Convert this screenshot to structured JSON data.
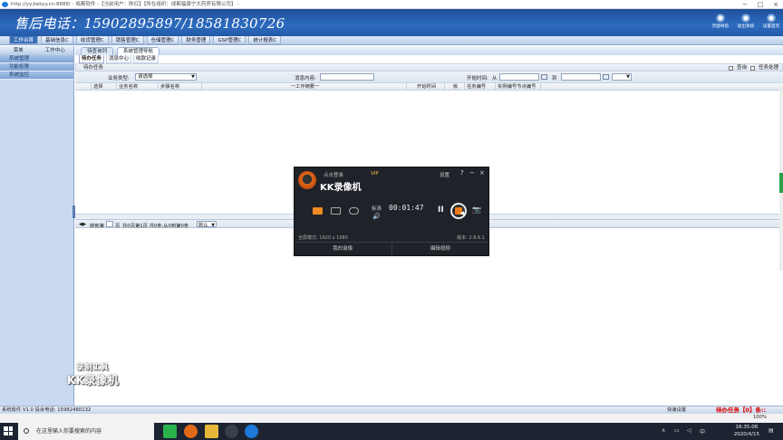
{
  "window": {
    "title": "http://yy.bekyy.cn:8888/ - 成都软件 -【当前用户：陈红】【所在组织：成都福康宁大药房有限公司】 -",
    "controls": [
      "−",
      "□",
      "×"
    ]
  },
  "banner": {
    "hotline": "售后电话：15902895897/18581830726",
    "tools": [
      {
        "label": "页面导航",
        "icon": "navigation-icon"
      },
      {
        "label": "退出系统",
        "icon": "logout-icon"
      },
      {
        "label": "设置首页",
        "icon": "home-settings-icon"
      }
    ]
  },
  "menubar": {
    "items": [
      "工作台首",
      "基础信息C",
      "收货管理C",
      "销售管理C",
      "仓储管理C",
      "财务管理",
      "GSP管理C",
      "统计报表C"
    ]
  },
  "sidebar": {
    "tabs": [
      "菜单",
      "工作中心"
    ],
    "items": [
      "系统管理",
      "功能权限",
      "系统监控"
    ]
  },
  "main": {
    "page_tabs": [
      "待查询列",
      "系统管理导航"
    ],
    "sub_tabs": [
      "待办任务",
      "消息中心",
      "收款记录"
    ],
    "panel_title": "待办任务",
    "panel_right": {
      "query": "查询",
      "toggle": "任务处理"
    },
    "filter": {
      "type_label": "业务类型:",
      "type_value": "请选择",
      "content_label": "消息内容:",
      "content_value": "",
      "start_label": "开始时间:",
      "from": "从",
      "to": "到",
      "from_value": "",
      "to_value": "",
      "range_value": ""
    },
    "columns": [
      "选择",
      "业务名称",
      "步骤名称",
      "一工作摘要一",
      "开始时间",
      "级",
      "任务编号",
      "实例编号节点编号"
    ],
    "pager": {
      "goto": "转到第",
      "page_unit": "页",
      "summary": "共0页第1页 共0条,从0到第0条",
      "page_size": "默认"
    }
  },
  "recorder": {
    "login": "点击登录",
    "vip": "VIP",
    "name": "KK录像机",
    "settings": "设置",
    "ctl_help": "?",
    "ctl_min": "−",
    "ctl_close": "×",
    "quality": "标清",
    "time": "00:01:47",
    "mode": "全屏模式: 1920 x 1080",
    "version": "版本: 2.8.6.1",
    "footer": [
      "我的录像",
      "编辑视频"
    ],
    "icons": {
      "volume": "🔊",
      "pause": "II",
      "camera": "📷"
    }
  },
  "watermark": {
    "line1": "录制工具",
    "line2": "KK录像机"
  },
  "statusbar": {
    "left": "系统软件 V1.0 投诉电话: 15982480132",
    "quick": "快速设置",
    "pending": "待办任务【0】条::"
  },
  "zoombar": {
    "zoom": "100%"
  },
  "taskbar": {
    "search_placeholder": "在这里输入你要搜索的内容",
    "clock_time": "16:35:06",
    "clock_date": "2020/4/15",
    "tray_lang": "中"
  }
}
